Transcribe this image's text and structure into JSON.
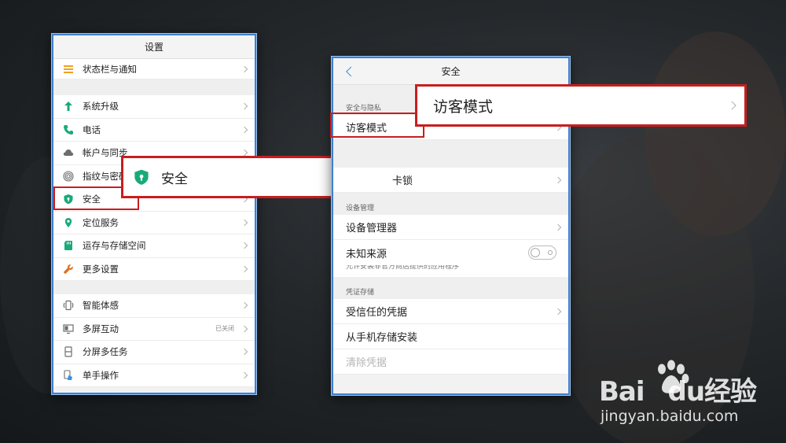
{
  "left_panel": {
    "title": "设置",
    "items": [
      {
        "label": "状态栏与通知",
        "icon": "menu-lines-icon",
        "color": "#f0a020"
      },
      {
        "label": "系统升级",
        "icon": "arrow-up-icon",
        "color": "#1aaa7a"
      },
      {
        "label": "电话",
        "icon": "phone-icon",
        "color": "#1aaa7a"
      },
      {
        "label": "帐户与同步",
        "icon": "cloud-icon",
        "color": "#6d6d6d"
      },
      {
        "label": "指纹与密码",
        "icon": "fingerprint-icon",
        "color": "#6d6d6d"
      },
      {
        "label": "安全",
        "icon": "shield-icon",
        "color": "#1aaa7a"
      },
      {
        "label": "定位服务",
        "icon": "location-pin-icon",
        "color": "#1aaa7a"
      },
      {
        "label": "运存与存储空间",
        "icon": "sd-card-icon",
        "color": "#1aaa7a"
      },
      {
        "label": "更多设置",
        "icon": "wrench-icon",
        "color": "#e07020"
      },
      {
        "label": "智能体感",
        "icon": "motion-phone-icon",
        "color": "#6d6d6d"
      },
      {
        "label": "多屏互动",
        "icon": "multiscreen-icon",
        "color": "#6d6d6d",
        "status": "已关闭"
      },
      {
        "label": "分屏多任务",
        "icon": "split-screen-icon",
        "color": "#6d6d6d"
      },
      {
        "label": "单手操作",
        "icon": "one-hand-icon",
        "color": "#3a8ee6"
      }
    ]
  },
  "security_callout": {
    "label": "安全"
  },
  "right_panel": {
    "title": "安全",
    "section_privacy": "安全与隐私",
    "guest_mode": "访客模式",
    "sim_lock_fragment": "卡锁",
    "section_device": "设备管理",
    "device_manager": "设备管理器",
    "unknown_sources": "未知来源",
    "unknown_sources_note": "允许安装非官方商店提供的应用程序",
    "section_credentials": "凭证存储",
    "trusted_credentials": "受信任的凭据",
    "install_from_storage": "从手机存储安装",
    "clear_credentials": "清除凭据"
  },
  "guest_callout": {
    "label": "访客模式"
  },
  "watermark": {
    "main_latin_1": "Bai",
    "main_latin_2": "du",
    "main_cn": "经验",
    "sub": "jingyan.baidu.com"
  },
  "colors": {
    "highlight": "#c81e1e",
    "panel_border": "#3d7fd0",
    "accent": "#3a8ee6"
  }
}
